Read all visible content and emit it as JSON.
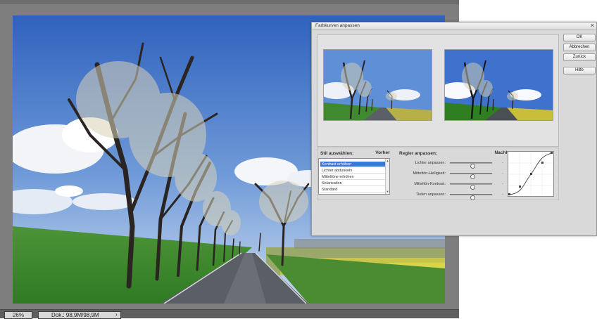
{
  "app": {
    "zoom": "26%",
    "doc_info": "Dok.: 98,9M/98,9M",
    "doc_arrow": "›"
  },
  "dialog": {
    "title": "Farbkurven anpassen",
    "close": "×",
    "buttons": {
      "ok": "OK",
      "cancel": "Abbrechen",
      "reset": "Zurück",
      "help": "Hilfe"
    },
    "preview": {
      "before_label": "Vorher",
      "after_label": "Nachher"
    },
    "style": {
      "label": "Stil auswählen:",
      "items": [
        "Kontrast erhöhen",
        "Lichter abdunkeln",
        "Mitteltöne erhöhen",
        "Solarisation",
        "Standard"
      ],
      "selected_index": 0
    },
    "sliders": {
      "label": "Regler anpassen:",
      "rows": [
        {
          "label": "Lichter anpassen:",
          "value": 0.55
        },
        {
          "label": "Mitteltön-Helligkeit:",
          "value": 0.55
        },
        {
          "label": "Mitteltön-Kontrast:",
          "value": 0.55
        },
        {
          "label": "Tiefen anpassen:",
          "value": 0.55
        }
      ],
      "dash": "-"
    }
  },
  "colors": {
    "sky_top": "#3e6fc0",
    "sky_bottom": "#a7c3ea",
    "grass": "#3f8a30",
    "accent_selection": "#3b78d8"
  }
}
